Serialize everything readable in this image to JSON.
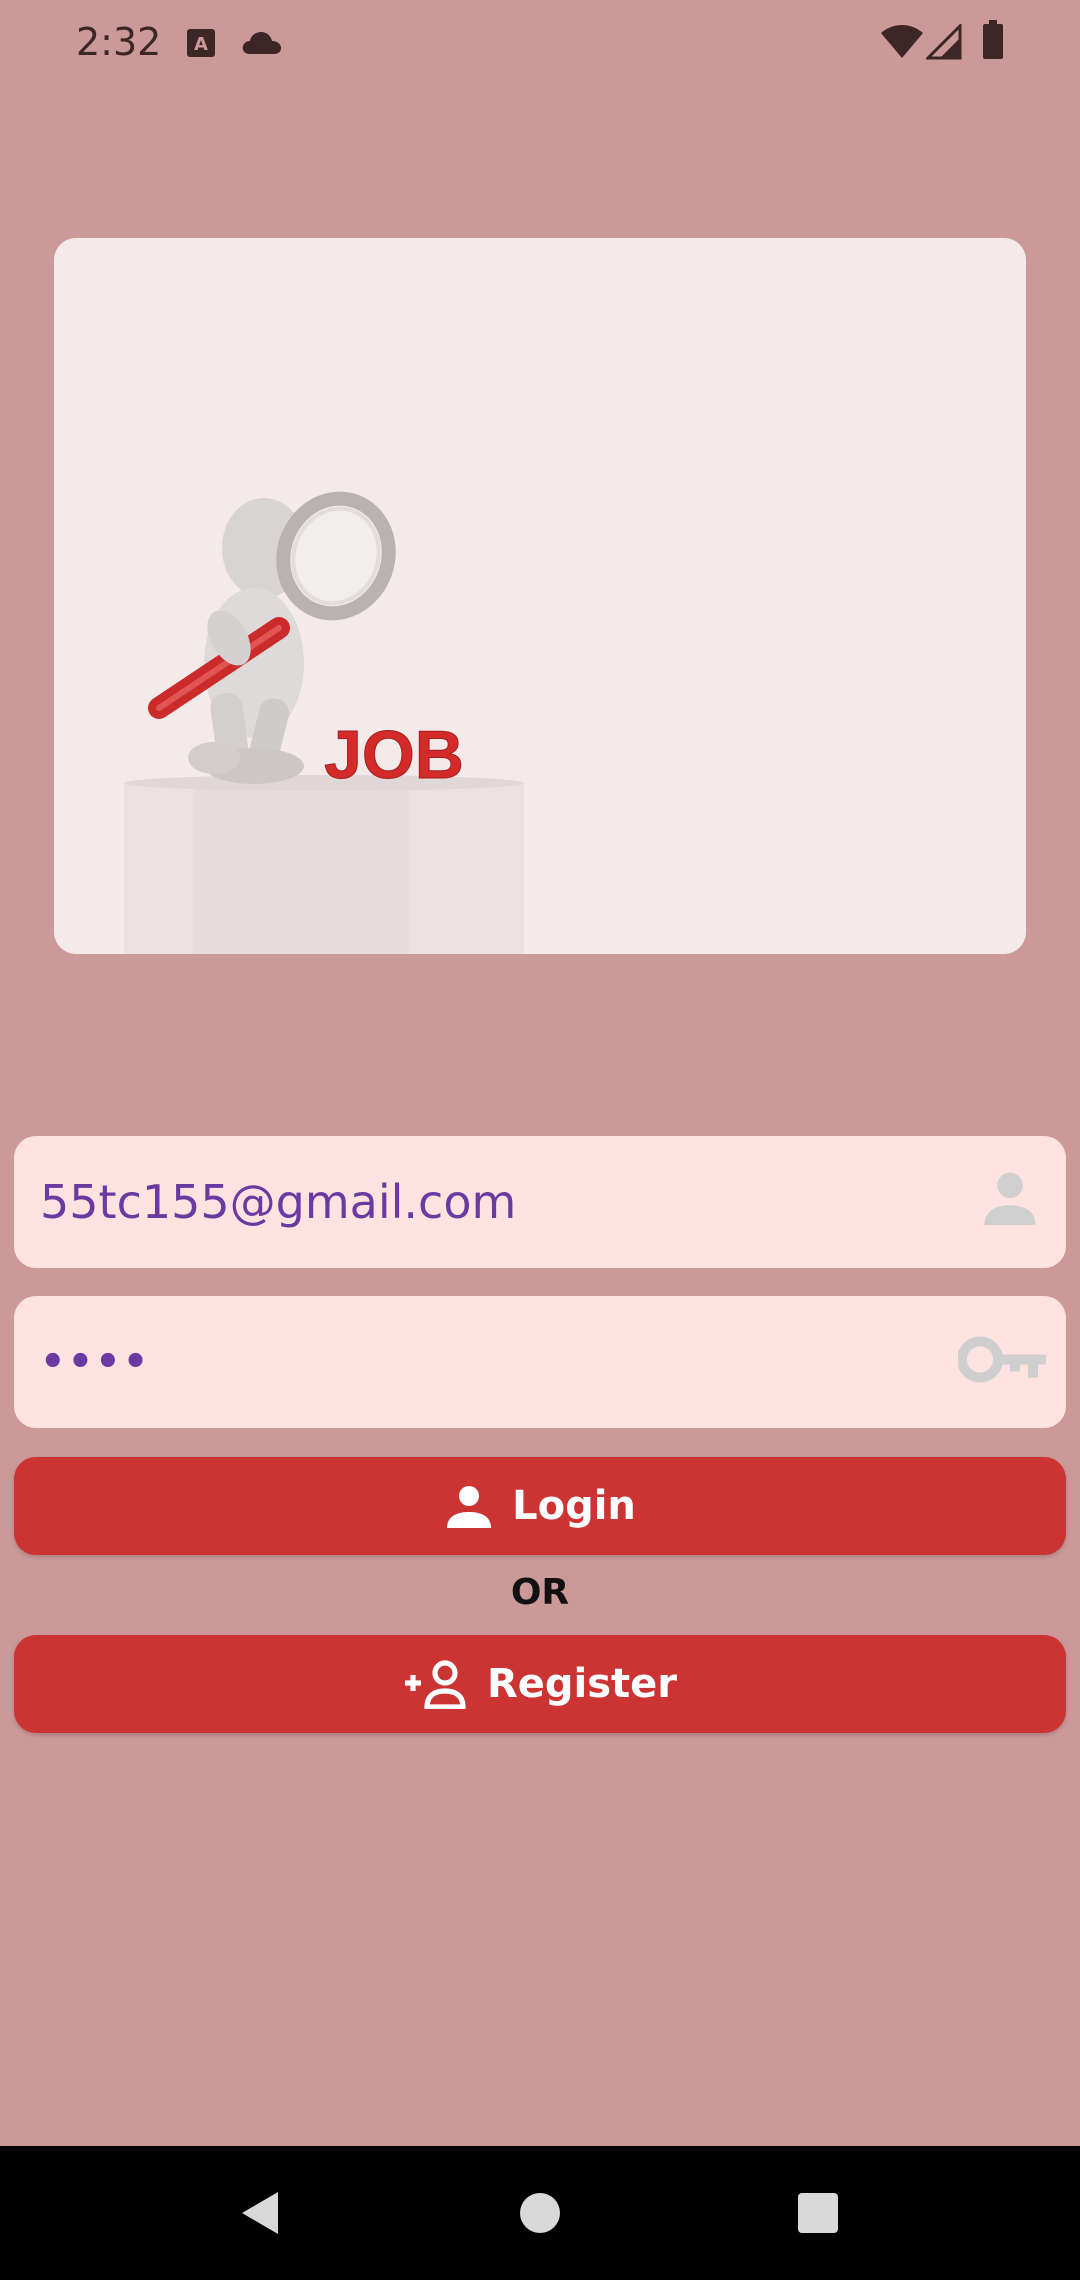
{
  "status_bar": {
    "time": "2:32",
    "left_icons": [
      "font-download-icon",
      "cloud-icon"
    ],
    "right_icons": [
      "wifi-icon",
      "cell-signal-icon",
      "battery-icon"
    ]
  },
  "hero": {
    "image": "job-search-figure-with-magnifier",
    "job_text": "JOB"
  },
  "login_form": {
    "email_value": "55tc155@gmail.com",
    "email_icon": "person-icon",
    "password_value": "••••",
    "password_icon": "key-icon",
    "login_label": "Login",
    "login_icon": "person-icon",
    "or_text": "OR",
    "register_label": "Register",
    "register_icon": "person-add-icon"
  },
  "nav_bar": {
    "items": [
      "back-icon",
      "home-icon",
      "recents-icon"
    ]
  },
  "colors": {
    "background": "#cc9999",
    "card": "#f4eaea",
    "field_bg": "#ffe3e1",
    "field_text": "#6b3aa0",
    "button": "#cc3333",
    "button_text": "#ffffff",
    "icon_muted": "#cfcfcf"
  }
}
